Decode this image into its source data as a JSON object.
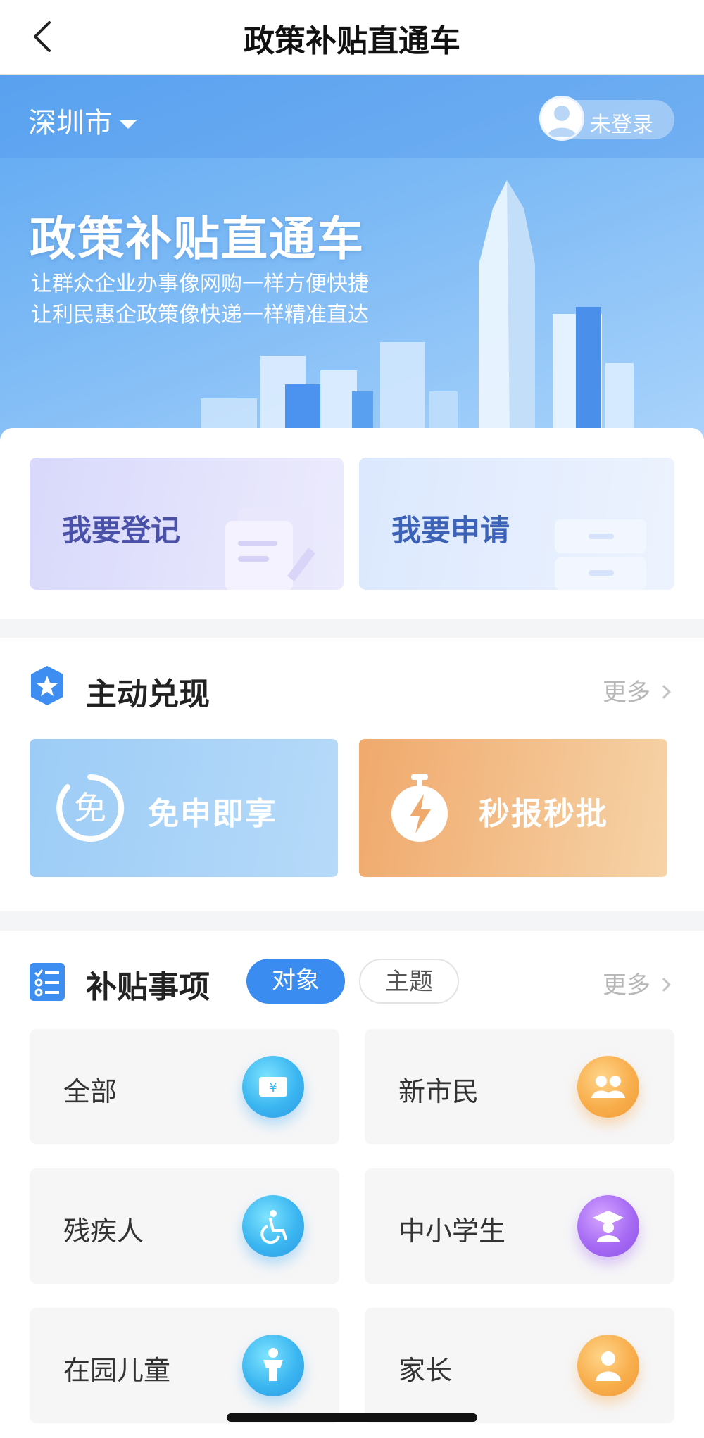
{
  "nav": {
    "title": "政策补贴直通车",
    "back_icon": "back-chevron-icon"
  },
  "hero": {
    "city": "深圳市",
    "login_label": "未登录",
    "title": "政策补贴直通车",
    "subtitle_1": "让群众企业办事像网购一样方便快捷",
    "subtitle_2": "让利民惠企政策像快递一样精准直达"
  },
  "actions": [
    {
      "label": "我要登记",
      "icon": "notepad-pen-icon"
    },
    {
      "label": "我要申请",
      "icon": "cabinet-icon"
    }
  ],
  "proactive": {
    "title": "主动兑现",
    "more": "更多",
    "items": [
      {
        "label": "免申即享",
        "icon": "free-badge-icon",
        "color": "#9cccf6"
      },
      {
        "label": "秒报秒批",
        "icon": "stopwatch-bolt-icon",
        "color": "#f0a96c"
      }
    ]
  },
  "subsidy": {
    "title": "补贴事项",
    "tabs": [
      "对象",
      "主题"
    ],
    "active_tab": "对象",
    "more": "更多",
    "items": [
      {
        "label": "全部",
        "icon": "ticket-yuan-icon",
        "color": "#3bb6f0"
      },
      {
        "label": "新市民",
        "icon": "people-group-icon",
        "color": "#f8ae4c"
      },
      {
        "label": "残疾人",
        "icon": "wheelchair-icon",
        "color": "#3bb6f0"
      },
      {
        "label": "中小学生",
        "icon": "graduate-icon",
        "color": "#a66af4"
      },
      {
        "label": "在园儿童",
        "icon": "child-icon",
        "color": "#3bb6f0"
      },
      {
        "label": "家长",
        "icon": "parent-icon",
        "color": "#f8ae4c"
      }
    ]
  }
}
